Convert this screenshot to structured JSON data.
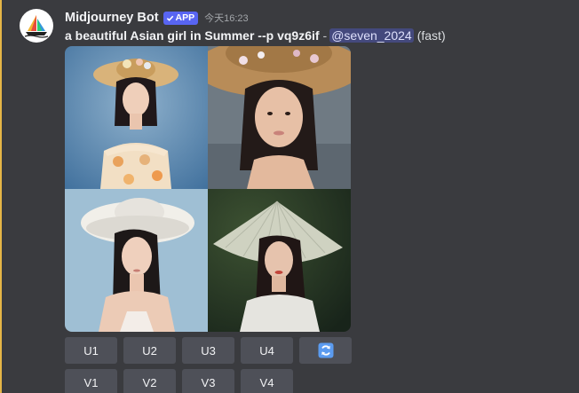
{
  "message": {
    "username": "Midjourney Bot",
    "badge_label": "APP",
    "timestamp": "今天16:23",
    "prompt": "a beautiful Asian girl in Summer --p vq9z6if",
    "separator": "-",
    "mention": "@seven_2024",
    "speed": "(fast)"
  },
  "images": [
    {
      "alt": "girl in straw hat with flowers, floral dress, blue background"
    },
    {
      "alt": "close-up girl in wide straw hat with flowers"
    },
    {
      "alt": "girl in white wide-brim hat, light blue background"
    },
    {
      "alt": "girl in woven conical hat, green background"
    }
  ],
  "buttons": {
    "upscale": [
      "U1",
      "U2",
      "U3",
      "U4"
    ],
    "variation": [
      "V1",
      "V2",
      "V3",
      "V4"
    ],
    "reroll_icon": "refresh-icon"
  },
  "colors": {
    "background": "#3a3b3f",
    "highlight": "#e6b647",
    "button": "#4e5058",
    "badge": "#5865f2",
    "mention_text": "#dee0fc",
    "reroll_icon": "#5b9bf0"
  }
}
